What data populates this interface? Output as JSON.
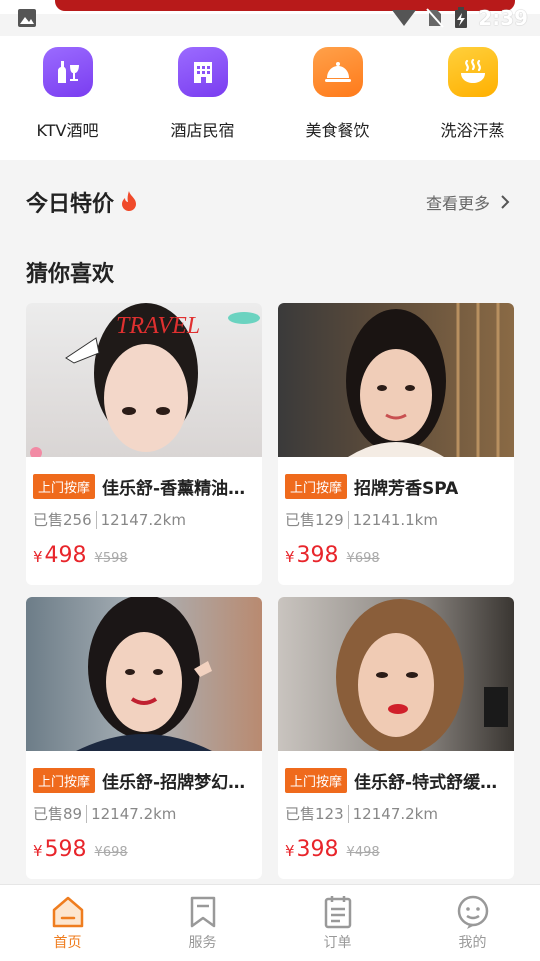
{
  "status_bar": {
    "time": "2:39"
  },
  "categories": [
    {
      "label": "KTV酒吧",
      "icon": "wine-bottle-icon"
    },
    {
      "label": "酒店民宿",
      "icon": "hotel-building-icon"
    },
    {
      "label": "美食餐饮",
      "icon": "food-cloche-icon"
    },
    {
      "label": "洗浴汗蒸",
      "icon": "steam-bath-icon"
    }
  ],
  "special": {
    "title": "今日特价",
    "more": "查看更多"
  },
  "guess": {
    "title": "猜你喜欢"
  },
  "products": [
    {
      "tag": "上门按摩",
      "name": "佳乐舒-香薰精油…",
      "sold": "已售256",
      "distance": "12147.2km",
      "currency": "¥",
      "price": "498",
      "original": "¥598",
      "photo_text": "TRAVEL"
    },
    {
      "tag": "上门按摩",
      "name": "招牌芳香SPA",
      "sold": "已售129",
      "distance": "12141.1km",
      "currency": "¥",
      "price": "398",
      "original": "¥698"
    },
    {
      "tag": "上门按摩",
      "name": "佳乐舒-招牌梦幻…",
      "sold": "已售89",
      "distance": "12147.2km",
      "currency": "¥",
      "price": "598",
      "original": "¥698"
    },
    {
      "tag": "上门按摩",
      "name": "佳乐舒-特式舒缓…",
      "sold": "已售123",
      "distance": "12147.2km",
      "currency": "¥",
      "price": "398",
      "original": "¥498"
    }
  ],
  "tabs": [
    {
      "label": "首页",
      "icon": "home-icon",
      "active": true
    },
    {
      "label": "服务",
      "icon": "bookmark-icon",
      "active": false
    },
    {
      "label": "订单",
      "icon": "clipboard-icon",
      "active": false
    },
    {
      "label": "我的",
      "icon": "smiley-face-icon",
      "active": false
    }
  ],
  "colors": {
    "accent": "#ef7d1f",
    "price": "#e8252b",
    "tag": "#ef6a1c"
  }
}
